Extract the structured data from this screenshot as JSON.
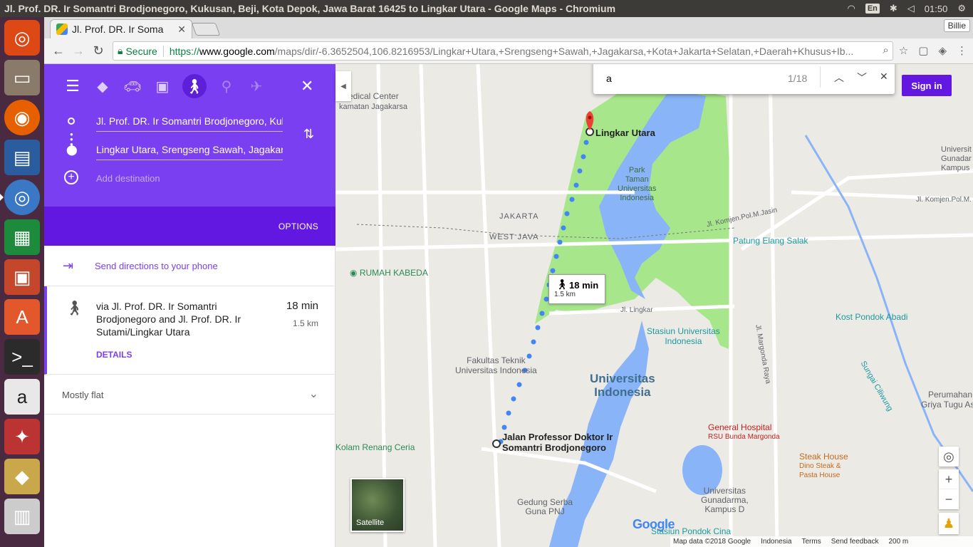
{
  "topbar": {
    "title": "Jl. Prof. DR. Ir Somantri Brodjonegoro, Kukusan, Beji, Kota Depok, Jawa Barat 16425 to Lingkar Utara - Google Maps - Chromium",
    "lang": "En",
    "clock": "01:50"
  },
  "browser": {
    "tab_title": "Jl. Prof. DR. Ir Soma",
    "user": "Billie",
    "secure_label": "Secure",
    "url_scheme": "https://",
    "url_host": "www.google.com",
    "url_path": "/maps/dir/-6.3652504,106.8216953/Lingkar+Utara,+Srengseng+Sawah,+Jagakarsa,+Kota+Jakarta+Selatan,+Daerah+Khusus+Ib..."
  },
  "directions": {
    "origin": "Jl. Prof. DR. Ir Somantri Brodjonegoro, Kukusan, Beji",
    "destination": "Lingkar Utara, Srengseng Sawah, Jagakarsa",
    "add_destination": "Add destination",
    "options_label": "OPTIONS",
    "send_label": "Send directions to your phone",
    "route": {
      "via": "via Jl. Prof. DR. Ir Somantri Brodjonegoro and Jl. Prof. DR. Ir Sutami/Lingkar Utara",
      "time": "18 min",
      "distance": "1.5 km",
      "details_label": "DETAILS"
    },
    "terrain": "Mostly flat"
  },
  "find": {
    "query": "a",
    "count": "1/18"
  },
  "map": {
    "sign_in": "Sign in",
    "bubble_time": "18 min",
    "bubble_dist": "1.5 km",
    "start_label_1": "Jalan Professor Doktor Ir",
    "start_label_2": "Somantri Brodjonegoro",
    "end_label": "Lingkar Utara",
    "park_1": "Park",
    "park_2": "Taman",
    "park_3": "Universitas",
    "park_4": "Indonesia",
    "ui_1": "Universitas",
    "ui_2": "Indonesia",
    "medical": "Medical Center",
    "kecamatan": "kamatan Jagakarsa",
    "jakarta": "JAKARTA",
    "west_java": "WEST JAVA",
    "rumah_kabeda": "RUMAH KABEDA",
    "patung": "Patung Elang Salak",
    "kost": "Kost Pondok Abadi",
    "stasiun_ui_1": "Stasiun Universitas",
    "stasiun_ui_2": "Indonesia",
    "fakultas_1": "Fakultas Teknik",
    "fakultas_2": "Universitas Indonesia",
    "general_hospital_1": "General Hospital",
    "general_hospital_2": "RSU Bunda Margonda",
    "steak_1": "Steak House",
    "steak_2": "Dino Steak &",
    "steak_3": "Pasta House",
    "kolam": "Kolam Renang Ceria",
    "gedung_1": "Gedung Serba",
    "gedung_2": "Guna PNJ",
    "gunadarma_1": "Universitas",
    "gunadarma_2": "Gunadarma,",
    "gunadarma_3": "Kampus D",
    "perumahan_1": "Perumahan",
    "perumahan_2": "Griya Tugu Asri",
    "gunadar_right_1": "Universit",
    "gunadar_right_2": "Gunadar",
    "gunadar_right_3": "Kampus",
    "stasiun_pondok_cina": "Stasiun Pondok Cina",
    "jasin": "Jl. Komjen.Pol.M.Jasin",
    "komjen_right": "Jl. Komjen.Pol.M.",
    "margonda": "Jl. Margonda Raya",
    "sungai": "Sungai Ciliwung",
    "jl_lingkar": "Jl. Lingkar",
    "satellite": "Satellite",
    "google": "Google",
    "footer_data": "Map data ©2018 Google",
    "footer_country": "Indonesia",
    "footer_terms": "Terms",
    "footer_feedback": "Send feedback",
    "footer_scale": "200 m"
  },
  "colors": {
    "accent": "#7b3ff2",
    "accent_dark": "#6218e0",
    "park": "#a7e68a",
    "water": "#8ab4f8",
    "route_dot": "#4285f4"
  }
}
